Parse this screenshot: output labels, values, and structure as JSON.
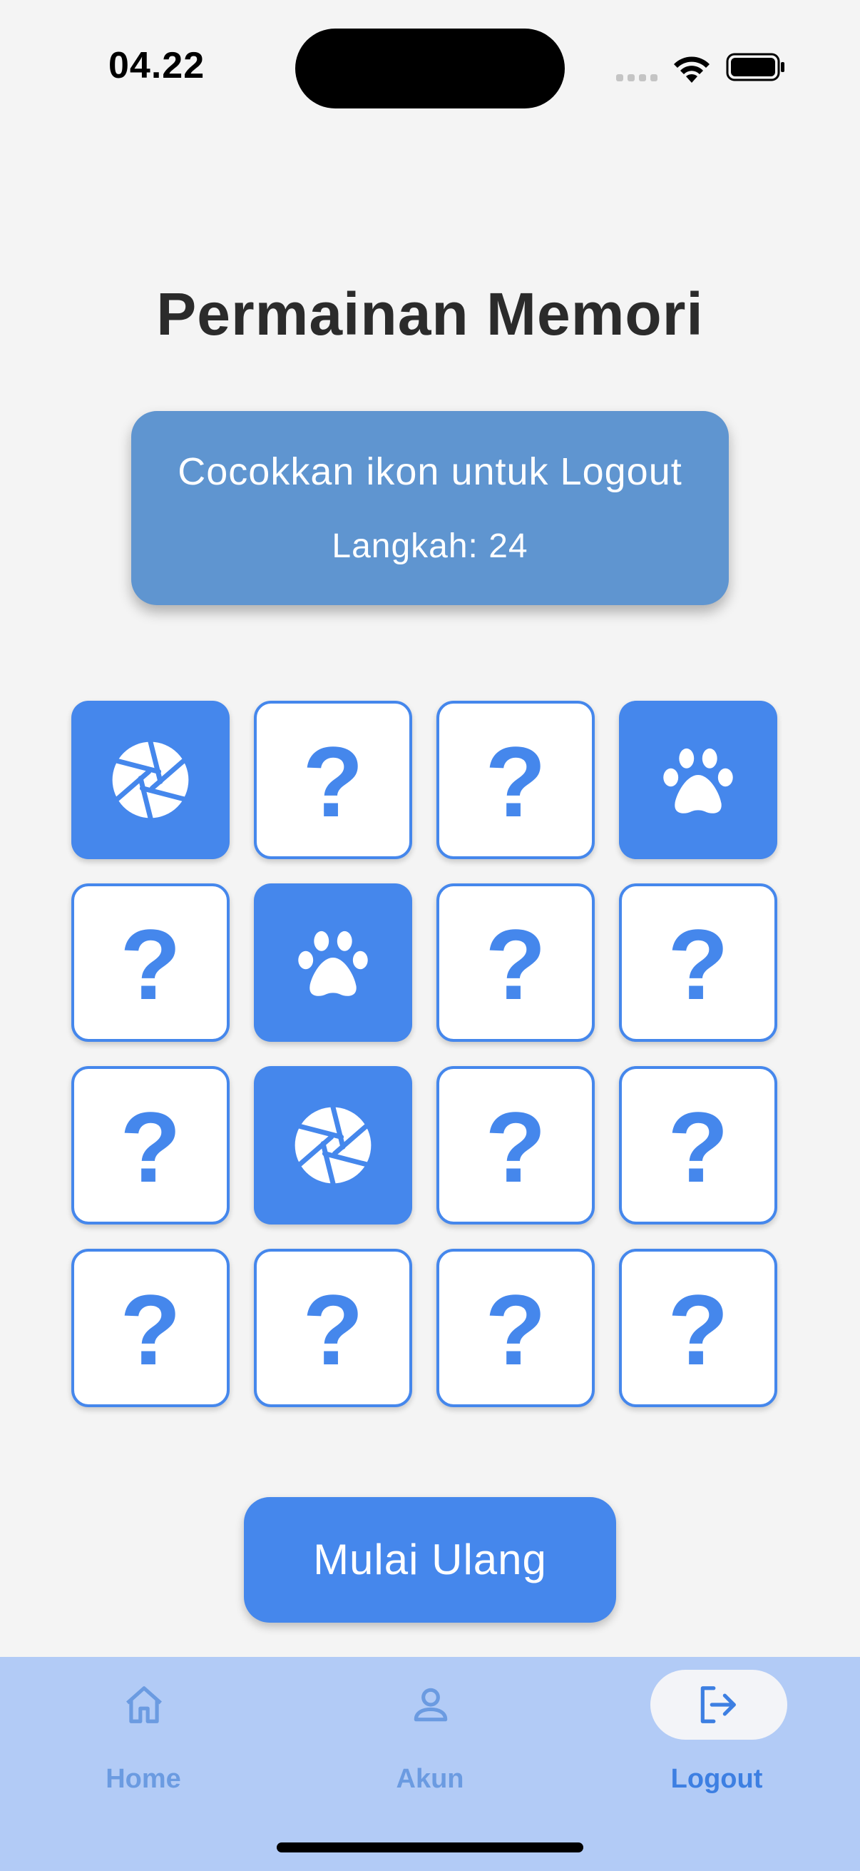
{
  "status_bar": {
    "time": "04.22",
    "icons": [
      "cellular-signal-icon",
      "wifi-icon",
      "battery-icon"
    ]
  },
  "title": "Permainan Memori",
  "info": {
    "instruction": "Cocokkan ikon untuk Logout",
    "steps": "Langkah: 24"
  },
  "grid": {
    "columns": 4,
    "rows": 4,
    "hidden_symbol": "?",
    "cards": [
      {
        "state": "revealed",
        "icon": "camera-aperture-icon"
      },
      {
        "state": "hidden",
        "icon": "question-mark"
      },
      {
        "state": "hidden",
        "icon": "question-mark"
      },
      {
        "state": "revealed",
        "icon": "paw-icon"
      },
      {
        "state": "hidden",
        "icon": "question-mark"
      },
      {
        "state": "revealed",
        "icon": "paw-icon"
      },
      {
        "state": "hidden",
        "icon": "question-mark"
      },
      {
        "state": "hidden",
        "icon": "question-mark"
      },
      {
        "state": "hidden",
        "icon": "question-mark"
      },
      {
        "state": "revealed",
        "icon": "camera-aperture-icon"
      },
      {
        "state": "hidden",
        "icon": "question-mark"
      },
      {
        "state": "hidden",
        "icon": "question-mark"
      },
      {
        "state": "hidden",
        "icon": "question-mark"
      },
      {
        "state": "hidden",
        "icon": "question-mark"
      },
      {
        "state": "hidden",
        "icon": "question-mark"
      },
      {
        "state": "hidden",
        "icon": "question-mark"
      }
    ]
  },
  "restart_button": "Mulai Ulang",
  "nav": {
    "items": [
      {
        "label": "Home",
        "icon": "home-icon",
        "active": false
      },
      {
        "label": "Akun",
        "icon": "person-icon",
        "active": false
      },
      {
        "label": "Logout",
        "icon": "logout-icon",
        "active": true
      }
    ]
  },
  "colors": {
    "accent": "#4587ec",
    "info_card": "#5f95d0",
    "nav_background": "#b2cbf6",
    "background": "#f4f4f4"
  }
}
